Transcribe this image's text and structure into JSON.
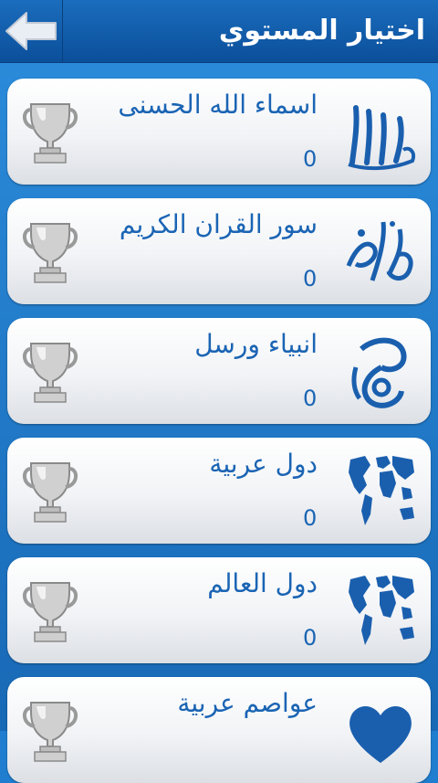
{
  "header": {
    "title": "اختيار المستوي",
    "back_icon": "back-arrow-icon"
  },
  "levels": [
    {
      "name": "اسماء الله الحسنى",
      "score": "0",
      "emblem_icon": "allah-calligraphy-icon",
      "trophy_icon": "trophy-icon"
    },
    {
      "name": "سور القران الكريم",
      "score": "0",
      "emblem_icon": "quran-calligraphy-icon",
      "trophy_icon": "trophy-icon"
    },
    {
      "name": "انبياء ورسل",
      "score": "0",
      "emblem_icon": "muhammad-calligraphy-icon",
      "trophy_icon": "trophy-icon"
    },
    {
      "name": "دول عربية",
      "score": "0",
      "emblem_icon": "world-map-icon",
      "trophy_icon": "trophy-icon"
    },
    {
      "name": "دول العالم",
      "score": "0",
      "emblem_icon": "world-map-icon",
      "trophy_icon": "trophy-icon"
    },
    {
      "name": "عواصم عربية",
      "score": "",
      "emblem_icon": "heart-icon",
      "trophy_icon": "trophy-icon"
    }
  ],
  "colors": {
    "accent": "#1a64b4",
    "background": "#1f7ed0",
    "trophy": "#c9c9c9"
  }
}
